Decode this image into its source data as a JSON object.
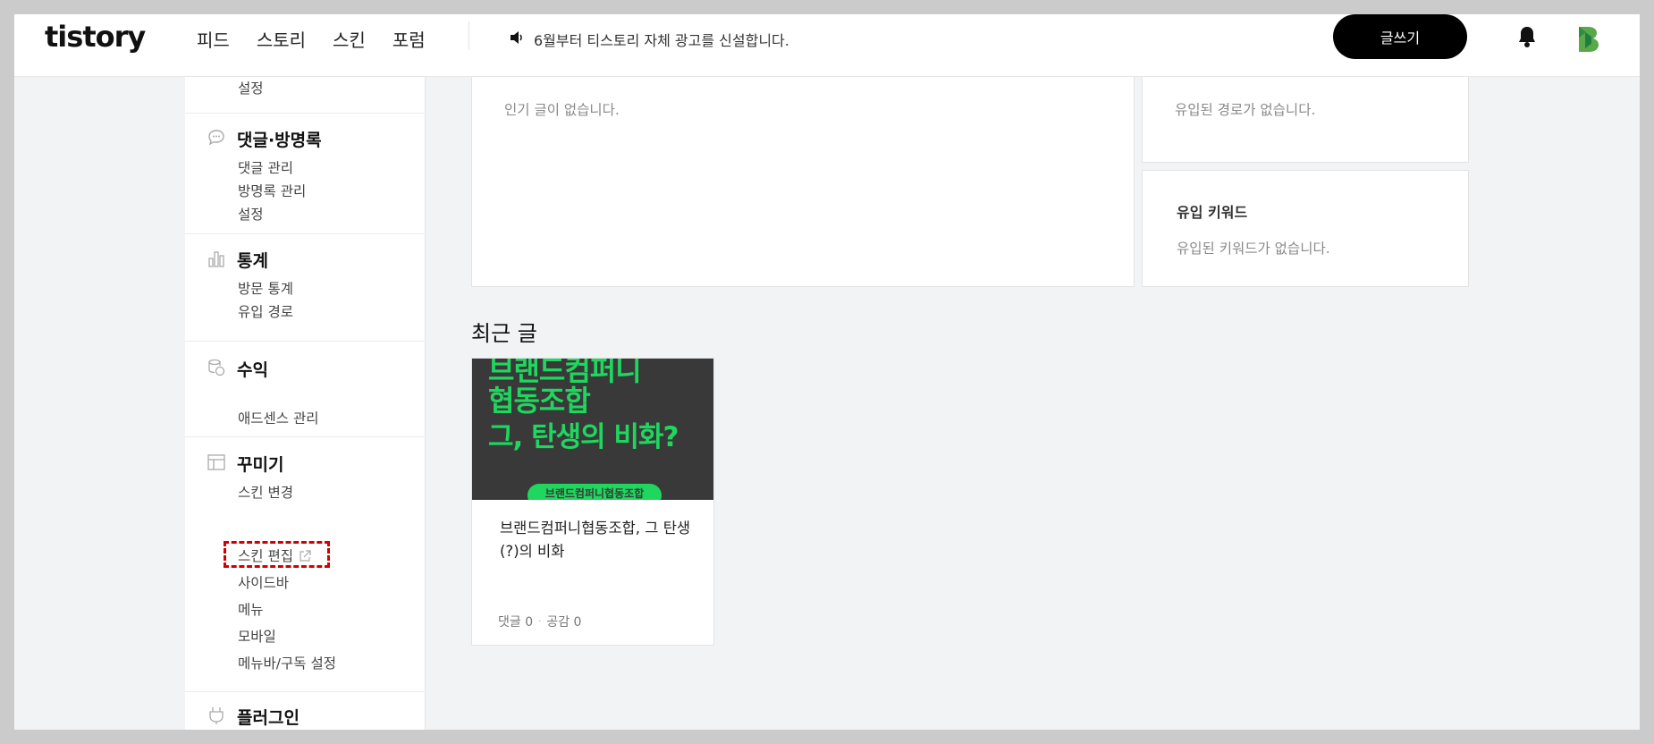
{
  "header": {
    "logo": "tistory",
    "nav": [
      "피드",
      "스토리",
      "스킨",
      "포럼"
    ],
    "notice_text": "6월부터 티스토리 자체 광고를 신설합니다.",
    "write_button": "글쓰기",
    "icons": {
      "notice": "speaker-icon",
      "bell": "bell-icon",
      "avatar": "blog-logo-avatar"
    }
  },
  "sidebar": {
    "partial_top_link": "설정",
    "sections": [
      {
        "title": "댓글·방명록",
        "icon": "comment-icon",
        "links": [
          "댓글 관리",
          "방명록 관리",
          "설정"
        ]
      },
      {
        "title": "통계",
        "icon": "bar-chart-icon",
        "links": [
          "방문 통계",
          "유입 경로"
        ]
      },
      {
        "title": "수익",
        "icon": "coins-icon",
        "links": [
          "애드센스 관리"
        ]
      },
      {
        "title": "꾸미기",
        "icon": "layout-icon",
        "links": [
          "스킨 변경",
          "스킨 편집",
          "사이드바",
          "메뉴",
          "모바일",
          "메뉴바/구독 설정"
        ]
      },
      {
        "title": "플러그인",
        "icon": "plug-icon",
        "links": []
      }
    ]
  },
  "main": {
    "popular_empty": "인기 글이 없습니다.",
    "referrer_empty": "유입된 경로가 없습니다.",
    "keyword_card": {
      "title": "유입 키워드",
      "empty": "유입된 키워드가 없습니다."
    },
    "recent_title": "최근 글",
    "posts": [
      {
        "thumb_lines": [
          "브랜드컴퍼니",
          "협동조합",
          "그, 탄생의 비화?"
        ],
        "thumb_pill": "브랜드컴퍼니협동조합",
        "title": "브랜드컴퍼니협동조합, 그 탄생(?)의 비화",
        "comments": "댓글 0",
        "likes": "공감 0"
      }
    ]
  },
  "colors": {
    "accent_green": "#1fd75f",
    "highlight_red": "#d40000"
  }
}
